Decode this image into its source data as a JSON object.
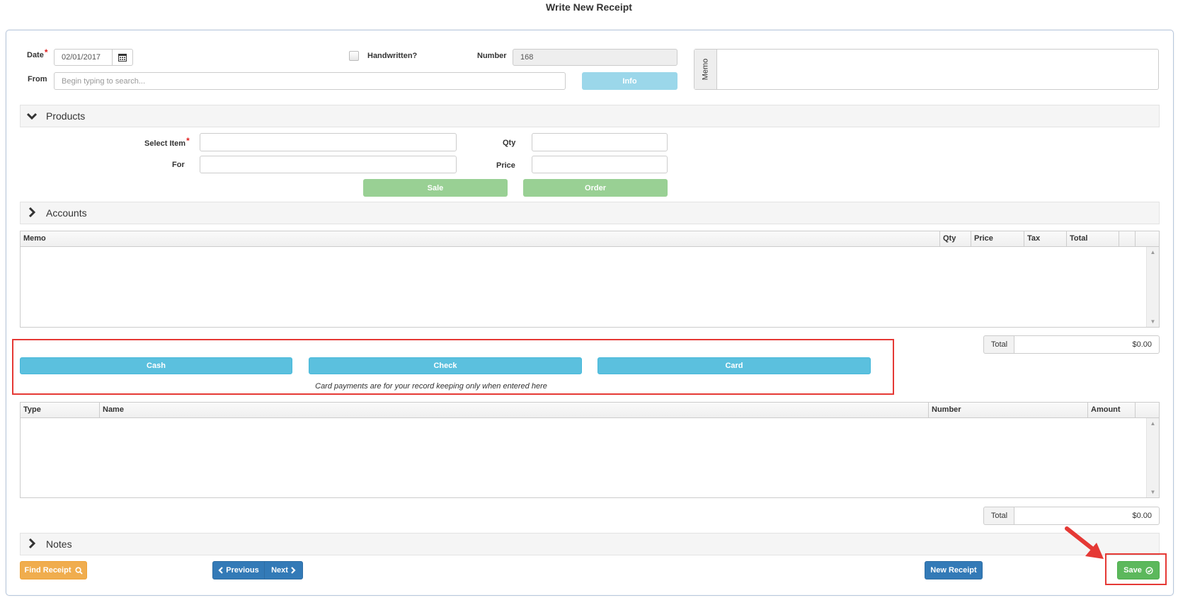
{
  "page": {
    "title": "Write New Receipt"
  },
  "header": {
    "date_label": "Date",
    "date_required": "*",
    "date_value": "02/01/2017",
    "handwritten_label": "Handwritten?",
    "number_label": "Number",
    "number_value": "168",
    "from_label": "From",
    "from_placeholder": "Begin typing to search...",
    "info_button": "Info",
    "memo_label": "Memo"
  },
  "products": {
    "title": "Products",
    "select_item_label": "Select Item",
    "select_item_required": "*",
    "qty_label": "Qty",
    "for_label": "For",
    "price_label": "Price",
    "sale_button": "Sale",
    "order_button": "Order"
  },
  "accounts": {
    "title": "Accounts",
    "columns": [
      "Memo",
      "Qty",
      "Price",
      "Tax",
      "Total"
    ],
    "total_label": "Total",
    "total_value": "$0.00"
  },
  "payments": {
    "cash_button": "Cash",
    "check_button": "Check",
    "card_button": "Card",
    "note": "Card payments are for your record keeping only when entered here",
    "columns": [
      "Type",
      "Name",
      "Number",
      "Amount"
    ],
    "total_label": "Total",
    "total_value": "$0.00"
  },
  "notes": {
    "title": "Notes"
  },
  "footer": {
    "find_receipt": "Find Receipt",
    "previous": "Previous",
    "next": "Next",
    "new_receipt": "New Receipt",
    "save": "Save"
  },
  "colors": {
    "primary_blue": "#337ab7",
    "info_blue": "#5bc0de",
    "success_green": "#5cb85c",
    "warning_orange": "#f0ad4e",
    "highlight_red": "#e53935"
  }
}
